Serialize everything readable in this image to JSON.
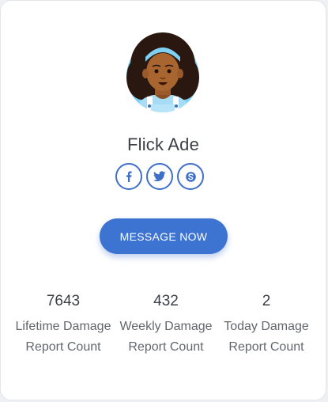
{
  "profile": {
    "name": "Flick Ade",
    "avatar_icon": "woman-avatar-icon"
  },
  "socials": [
    {
      "name": "facebook",
      "icon": "facebook-icon"
    },
    {
      "name": "twitter",
      "icon": "twitter-icon"
    },
    {
      "name": "skype",
      "icon": "skype-icon"
    }
  ],
  "actions": {
    "message_label": "MESSAGE NOW"
  },
  "stats": [
    {
      "value": "7643",
      "label": "Lifetime Damage Report Count"
    },
    {
      "value": "432",
      "label": "Weekly Damage Report Count"
    },
    {
      "value": "2",
      "label": "Today Damage Report Count"
    }
  ],
  "colors": {
    "accent": "#3d73d1",
    "card_background": "#ffffff",
    "avatar_background": "#7fcff2"
  }
}
